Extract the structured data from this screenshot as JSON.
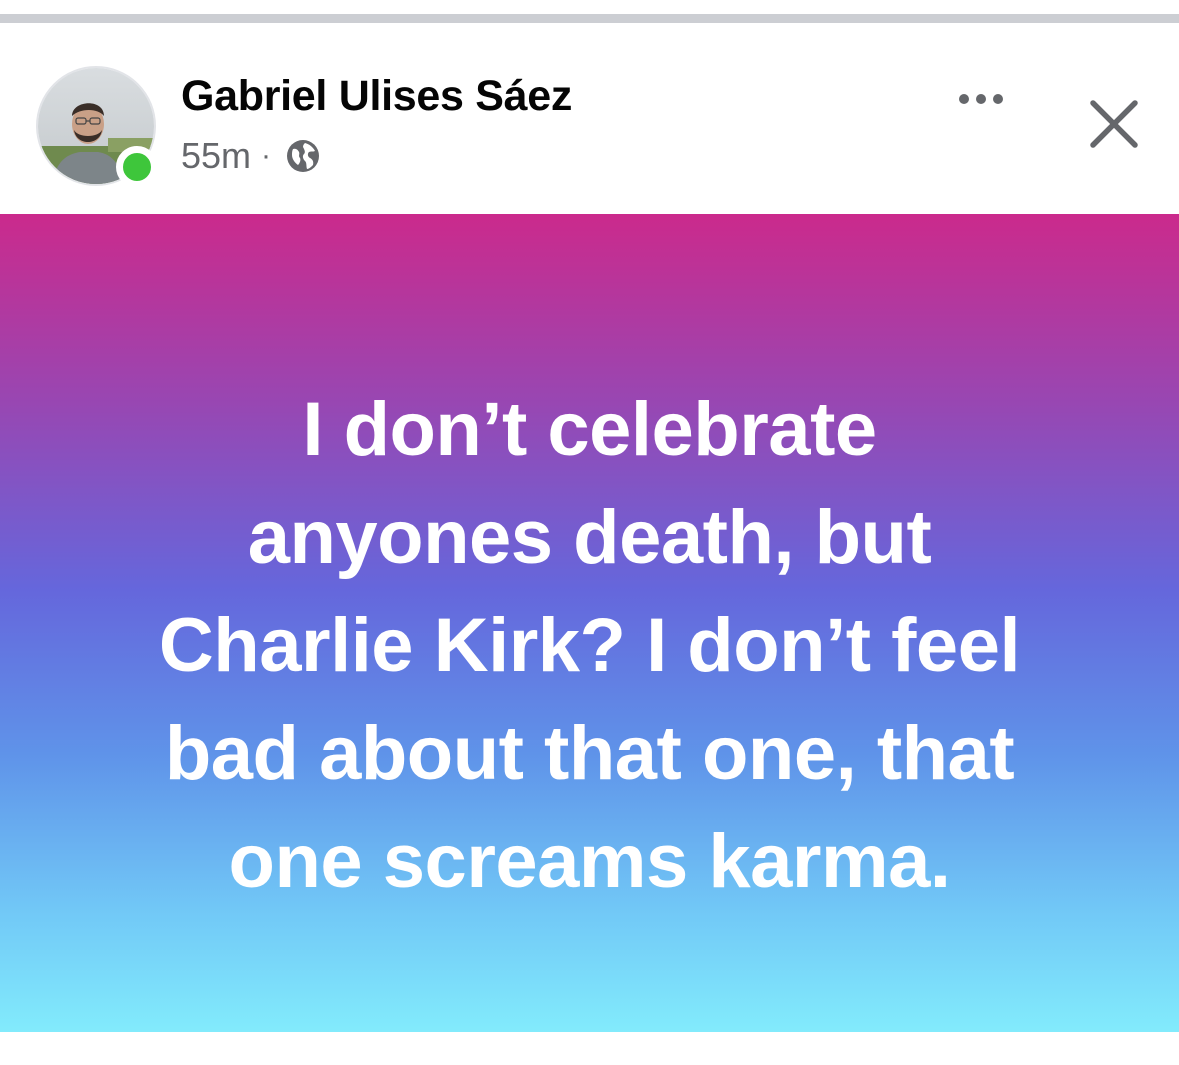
{
  "post": {
    "author_name": "Gabriel Ulises Sáez",
    "timestamp": "55m",
    "separator": "·",
    "audience_icon": "globe-icon",
    "author_online": true,
    "more_icon": "more-options-icon",
    "close_icon": "close-icon",
    "text_lines": [
      "I don’t celebrate",
      "anyones death, but",
      "Charlie Kirk? I don’t feel",
      "bad about that one, that",
      "one screams karma."
    ],
    "background_gradient": [
      "#cb2a8c",
      "#6567dc",
      "#82ebfc"
    ],
    "text_color": "#ffffff",
    "online_color": "#3ec63b"
  }
}
